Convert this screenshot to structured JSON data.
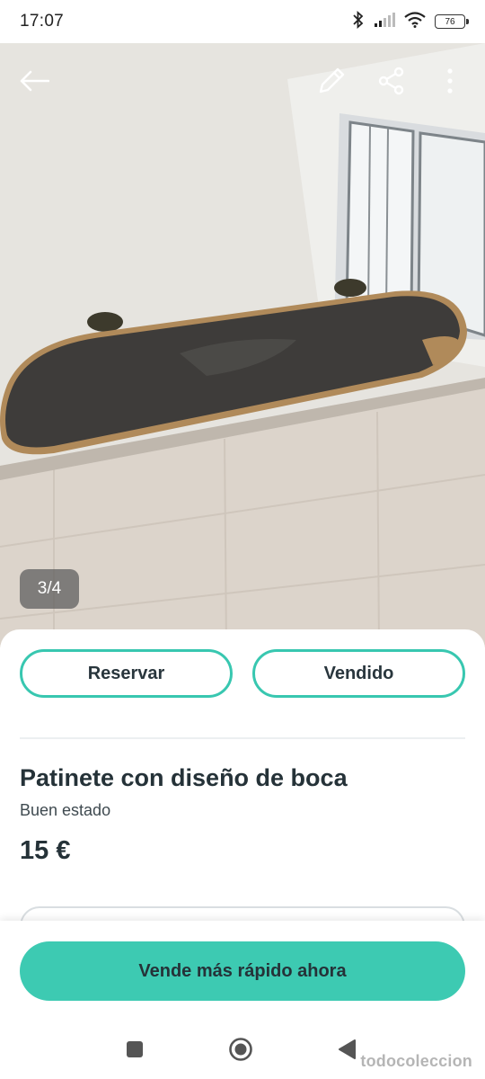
{
  "status_bar": {
    "time": "17:07",
    "battery": "76",
    "icons": [
      "bluetooth-icon",
      "signal-icon",
      "wifi-icon",
      "battery-icon"
    ]
  },
  "photo": {
    "counter": "3/4",
    "actions": [
      "back-arrow-icon",
      "edit-pencil-icon",
      "share-icon",
      "more-vert-icon"
    ]
  },
  "actions": {
    "reserve_label": "Reservar",
    "sold_label": "Vendido"
  },
  "item": {
    "title": "Patinete con diseño de boca",
    "condition": "Buen estado",
    "price": "15 €"
  },
  "cta": {
    "label": "Vende más rápido ahora"
  },
  "nav": {
    "items": [
      "recents-square-icon",
      "home-circle-icon",
      "back-triangle-icon"
    ]
  },
  "watermark": "todocoleccion",
  "colors": {
    "accent": "#3dcab2",
    "outline": "#38c7b0",
    "text": "#253238"
  }
}
